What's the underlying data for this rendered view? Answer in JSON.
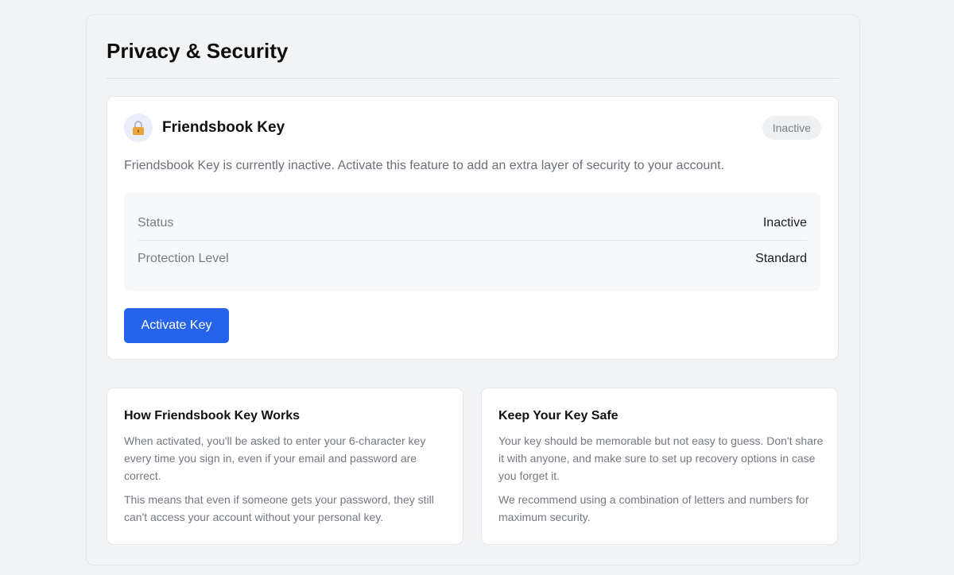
{
  "page": {
    "title": "Privacy & Security"
  },
  "key_card": {
    "icon": "lock-icon",
    "title": "Friendsbook Key",
    "badge": "Inactive",
    "description": "Friendsbook Key is currently inactive. Activate this feature to add an extra layer of security to your account.",
    "rows": [
      {
        "label": "Status",
        "value": "Inactive"
      },
      {
        "label": "Protection Level",
        "value": "Standard"
      }
    ],
    "activate_label": "Activate Key"
  },
  "info_cards": [
    {
      "title": "How Friendsbook Key Works",
      "p1": "When activated, you'll be asked to enter your 6-character key every time you sign in, even if your email and password are correct.",
      "p2": "This means that even if someone gets your password, they still can't access your account without your personal key."
    },
    {
      "title": "Keep Your Key Safe",
      "p1": "Your key should be memorable but not easy to guess. Don't share it with anyone, and make sure to set up recovery options in case you forget it.",
      "p2": "We recommend using a combination of letters and numbers for maximum security."
    }
  ],
  "colors": {
    "accent": "#2563eb",
    "badge_bg": "#eef0f2",
    "lock": "#e8a33d"
  }
}
